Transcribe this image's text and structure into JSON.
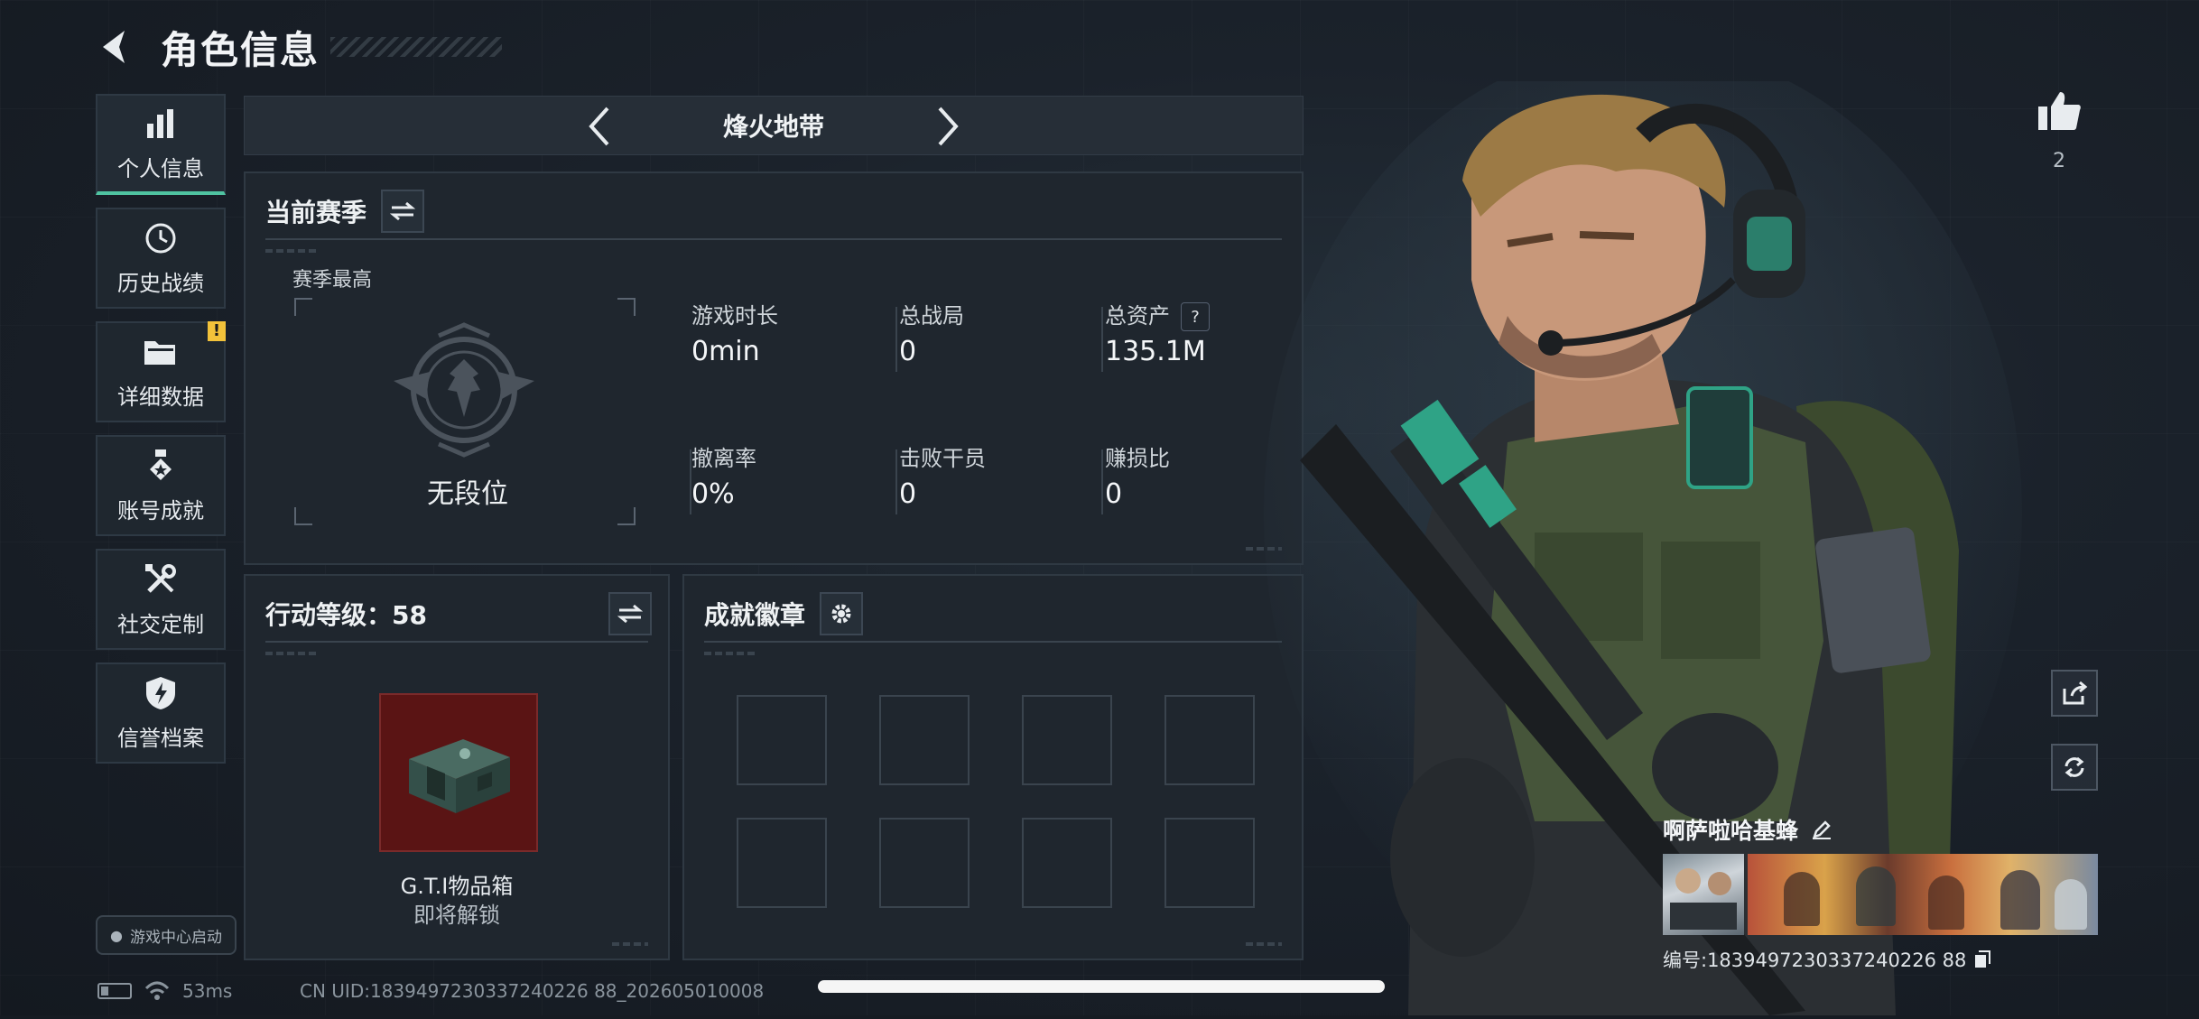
{
  "header": {
    "title": "角色信息"
  },
  "sidebar": {
    "items": [
      {
        "label": "个人信息",
        "icon": "bar-chart-icon",
        "active": true
      },
      {
        "label": "历史战绩",
        "icon": "clock-history-icon"
      },
      {
        "label": "详细数据",
        "icon": "folder-icon",
        "badge": "!"
      },
      {
        "label": "账号成就",
        "icon": "medal-icon"
      },
      {
        "label": "社交定制",
        "icon": "tools-icon"
      },
      {
        "label": "信誉档案",
        "icon": "shield-bolt-icon"
      }
    ],
    "game_center": "游戏中心启动"
  },
  "mode_selector": {
    "label": "烽火地带"
  },
  "season_panel": {
    "title": "当前赛季",
    "highest_label": "赛季最高",
    "rank": "无段位",
    "stats": [
      {
        "label": "游戏时长",
        "value": "0min"
      },
      {
        "label": "总战局",
        "value": "0"
      },
      {
        "label": "总资产",
        "value": "135.1M",
        "help": "?"
      },
      {
        "label": "撤离率",
        "value": "0%"
      },
      {
        "label": "击败干员",
        "value": "0"
      },
      {
        "label": "赚损比",
        "value": "0"
      }
    ]
  },
  "level_panel": {
    "title": "行动等级：58",
    "reward_name": "G.T.I物品箱",
    "reward_status": "即将解锁"
  },
  "badge_panel": {
    "title": "成就徽章",
    "slot_count": 8
  },
  "profile": {
    "likes": "2",
    "name": "啊萨啦哈基蜂",
    "id": "编号:1839497230337240226 88"
  },
  "status": {
    "ping": "53ms",
    "uid": "CN UID:1839497230337240226 88_202605010008"
  },
  "colors": {
    "accent": "#4fc3a1",
    "warning": "#f2c23a",
    "reward_bg": "#5a1414"
  }
}
